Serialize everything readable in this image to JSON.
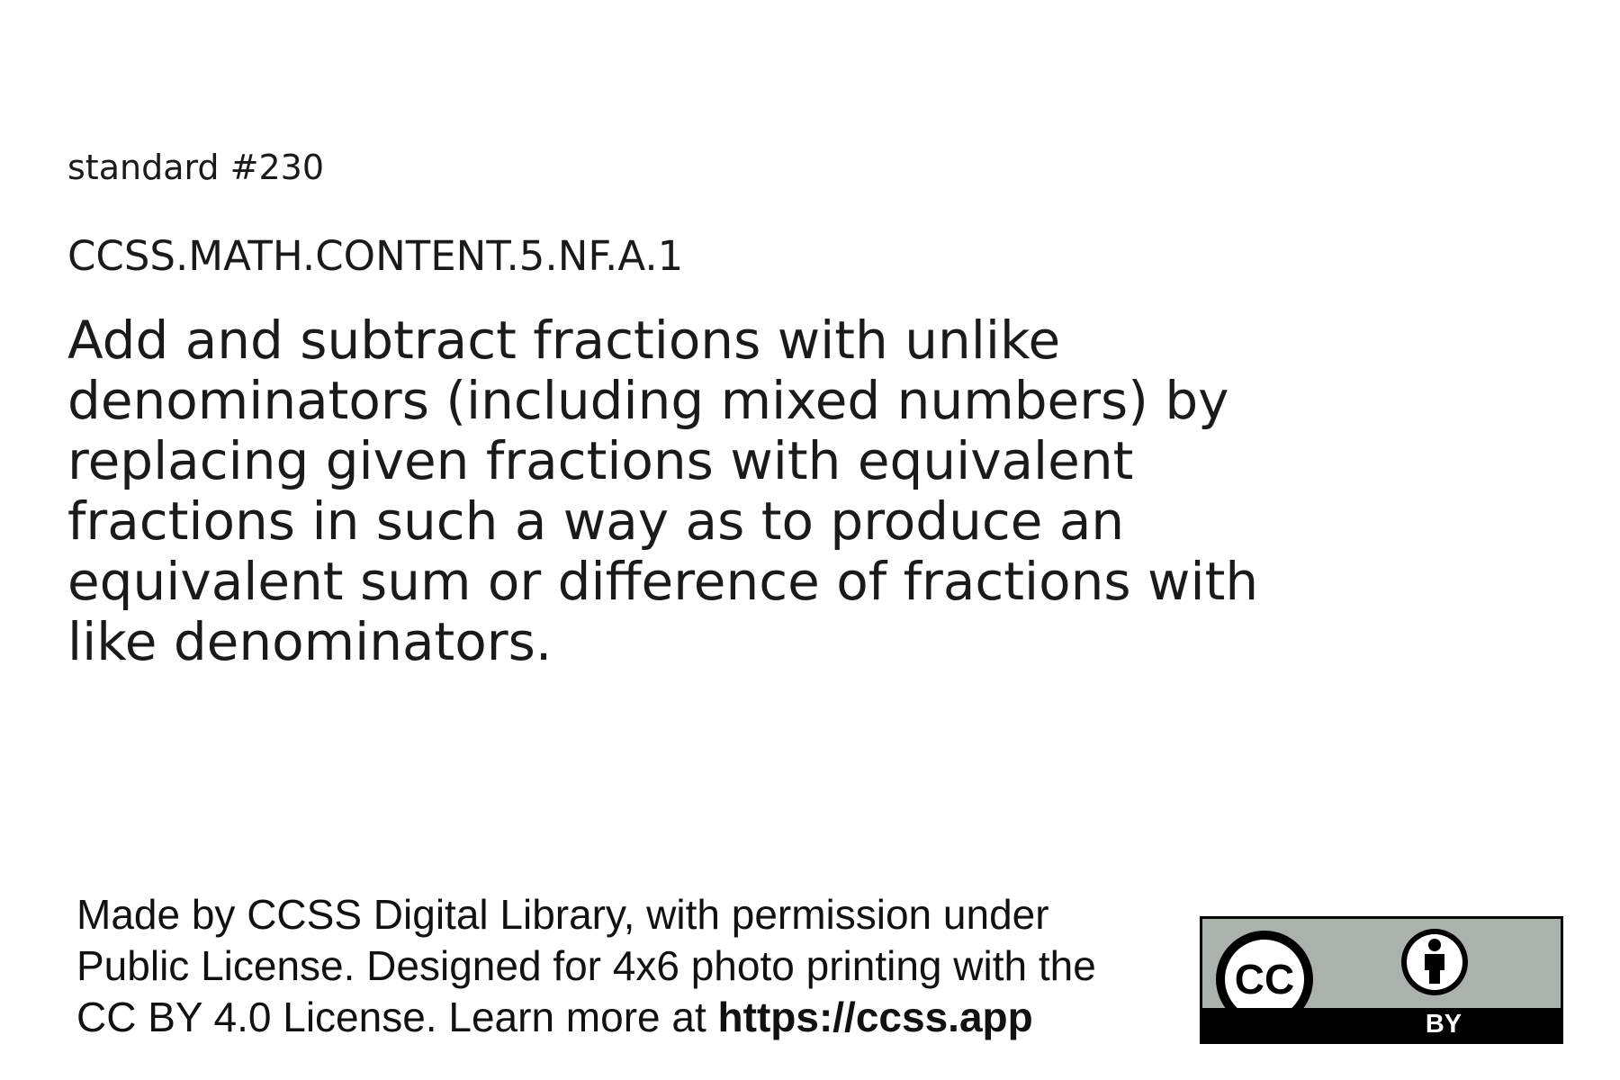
{
  "standard": {
    "number_label": "standard #230",
    "code": "CCSS.MATH.CONTENT.5.NF.A.1",
    "description": "Add and subtract fractions with unlike denominators (including mixed numbers) by replacing given fractions with equivalent fractions in such a way as to produce an equivalent sum or difference of fractions with like denominators."
  },
  "footer": {
    "line1": "Made by CCSS Digital Library, with permission under",
    "line2": "Public License. Designed for 4x6 photo printing with the",
    "line3_prefix": "CC BY 4.0 License. Learn more at ",
    "url": "https://ccss.app"
  },
  "license_badge": {
    "cc_text": "CC",
    "by_text": "BY",
    "icons": [
      "cc-icon",
      "attribution-person-icon"
    ],
    "colors": {
      "badge_background": "#aab2ab",
      "badge_bar": "#000000"
    }
  }
}
